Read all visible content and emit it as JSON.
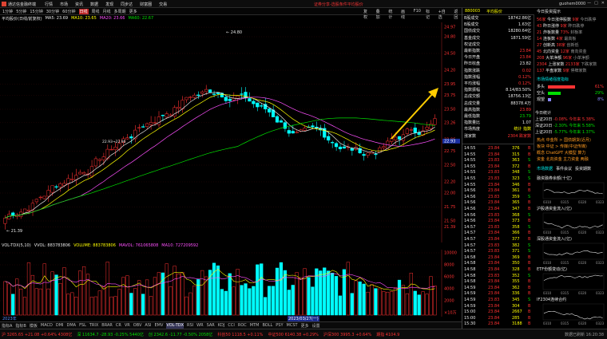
{
  "titlebar": {
    "app": "通达信金融终端",
    "menu": [
      "行情",
      "市场",
      "资讯",
      "数据",
      "发现",
      "同步达",
      "财富圈",
      "交易"
    ],
    "center": "证券分享-选股条件平均股价",
    "right": "guohem0000",
    "win_buttons": [
      "—",
      "□",
      "✕"
    ]
  },
  "toolbar": {
    "periods": [
      "1分钟",
      "5分钟",
      "15分钟",
      "30分钟",
      "60分钟",
      "日线",
      "周线",
      "月线",
      "多周期",
      "更多"
    ],
    "active_period": "日线",
    "tools": [
      "复权",
      "叠加",
      "统计",
      "画线",
      "F10",
      "标记",
      "+自选",
      "返回"
    ]
  },
  "legend": {
    "name": "平均股价(日线/前复权)",
    "ma": [
      {
        "text": "MA5: 23.69",
        "color": "#e8e8e8"
      },
      {
        "text": "MA10: 23.65",
        "color": "#ffff00"
      },
      {
        "text": "MA20: 23.66",
        "color": "#ff50ff"
      },
      {
        "text": "MA60: 22.67",
        "color": "#00e000"
      }
    ]
  },
  "price_axis": {
    "ticks": [
      "24.97",
      "24.80",
      "24.50",
      "24.20",
      "23.95",
      "23.75",
      "23.50",
      "23.26",
      "22.96",
      "22.75",
      "22.50",
      "22.20",
      "22.00",
      "21.75",
      "21.50",
      "21.39"
    ],
    "current": "22.93"
  },
  "annotations": {
    "high": "24.80",
    "low": "21.39",
    "mark": "22.93→22.96"
  },
  "vol_legend": {
    "items": [
      {
        "text": "VOL-TDX(5,10)",
        "color": "#e8e8e8"
      },
      {
        "text": "VVOL: 883783806",
        "color": "#e8e8e8"
      },
      {
        "text": "VOLUME: 883783806",
        "color": "#ffff00"
      },
      {
        "text": "MAVOL: 761065808",
        "color": "#ff50ff"
      },
      {
        "text": "MA10: 727209592",
        "color": "#ff50ff"
      }
    ]
  },
  "vol_axis": {
    "ticks": [
      "10000",
      "8000",
      "6000",
      "4000",
      "2000",
      "×10万"
    ]
  },
  "date_strip": {
    "left": "2023年",
    "mid": "2023/03/27(一)"
  },
  "indicator_tabs": {
    "items": [
      "指标A",
      "指标B",
      "模板",
      "MACD",
      "DMI",
      "DMA",
      "FSL",
      "TRIX",
      "BRAR",
      "CR",
      "VR",
      "OBV",
      "ASI",
      "EMV",
      "VOL-TDX",
      "RSI",
      "WR",
      "SAR",
      "KDJ",
      "CCI",
      "ROC",
      "MTM",
      "BOLL",
      "PSY",
      "MCST",
      "更多",
      "设置"
    ],
    "active": "VOL-TDX"
  },
  "quote": {
    "code": "880003",
    "name": "平均股价",
    "rows": [
      {
        "label": "B股成交",
        "value": "18742.86亿",
        "cls": "white"
      },
      {
        "label": "B股成交",
        "value": "1.63亿",
        "cls": "white"
      },
      {
        "label": "国债成交",
        "value": "18280.64亿",
        "cls": "white"
      },
      {
        "label": "基金成交",
        "value": "1871.59亿",
        "cls": "white"
      },
      {
        "label": "权证成交",
        "value": "",
        "cls": "white"
      },
      {
        "label": "最新指数",
        "value": "23.84",
        "cls": "red"
      },
      {
        "label": "今日开盘",
        "value": "23.84",
        "cls": "red"
      },
      {
        "label": "昨日收盘",
        "value": "23.82",
        "cls": "white"
      },
      {
        "label": "指数涨跌",
        "value": "0.02",
        "cls": "red"
      },
      {
        "label": "指数涨幅",
        "value": "0.12%",
        "cls": "red"
      },
      {
        "label": "平均涨幅",
        "value": "0.12%",
        "cls": "red"
      },
      {
        "label": "指数振幅",
        "value": "8.14/83.50%",
        "cls": "white"
      },
      {
        "label": "总成交额",
        "value": "18756.13亿",
        "cls": "white"
      },
      {
        "label": "总成交量",
        "value": "88378.4万",
        "cls": "white"
      },
      {
        "label": "最高指数",
        "value": "23.89",
        "cls": "red"
      },
      {
        "label": "最低指数",
        "value": "23.79",
        "cls": "green"
      },
      {
        "label": "指数量比",
        "value": "1.07",
        "cls": "white"
      },
      {
        "label": "市场热度",
        "value": "统计 指数",
        "cls": "yellow"
      },
      {
        "label": "涨家数",
        "value": "2304 跌家数",
        "cls": "red"
      }
    ],
    "breadth": [
      {
        "label": "今日统计",
        "value": "",
        "cls": "yellow"
      },
      {
        "label": "上证20日",
        "value": "-0.08% 今年来 5.38%",
        "cls": "red"
      },
      {
        "label": "深证20日",
        "value": "-2.30% 今年来 5.58%",
        "cls": "green"
      },
      {
        "label": "上证20日",
        "value": "-5.77% 今年来 1.37%",
        "cls": "green"
      }
    ]
  },
  "ticks": [
    {
      "time": "14:55",
      "price": "23.84",
      "vol": "376",
      "side": "B"
    },
    {
      "time": "14:55",
      "price": "23.84",
      "vol": "315",
      "side": "B"
    },
    {
      "time": "14:55",
      "price": "23.83",
      "vol": "363",
      "side": "S"
    },
    {
      "time": "14:55",
      "price": "23.84",
      "vol": "372",
      "side": "B"
    },
    {
      "time": "14:55",
      "price": "23.83",
      "vol": "348",
      "side": "S"
    },
    {
      "time": "14:55",
      "price": "23.83",
      "vol": "323",
      "side": "S"
    },
    {
      "time": "14:55",
      "price": "23.84",
      "vol": "346",
      "side": "B"
    },
    {
      "time": "14:56",
      "price": "23.84",
      "vol": "361",
      "side": "B"
    },
    {
      "time": "14:56",
      "price": "23.83",
      "vol": "359",
      "side": "S"
    },
    {
      "time": "14:56",
      "price": "23.84",
      "vol": "365",
      "side": "B"
    },
    {
      "time": "14:56",
      "price": "23.84",
      "vol": "347",
      "side": "B"
    },
    {
      "time": "14:56",
      "price": "23.83",
      "vol": "368",
      "side": "S"
    },
    {
      "time": "14:56",
      "price": "23.84",
      "vol": "373",
      "side": "B"
    },
    {
      "time": "14:57",
      "price": "23.83",
      "vol": "358",
      "side": "S"
    },
    {
      "time": "14:57",
      "price": "23.84",
      "vol": "366",
      "side": "B"
    },
    {
      "time": "14:57",
      "price": "23.84",
      "vol": "377",
      "side": "B"
    },
    {
      "time": "14:57",
      "price": "23.83",
      "vol": "382",
      "side": "S"
    },
    {
      "time": "14:57",
      "price": "23.83",
      "vol": "371",
      "side": "S"
    },
    {
      "time": "14:58",
      "price": "23.84",
      "vol": "369",
      "side": "B"
    },
    {
      "time": "14:58",
      "price": "23.84",
      "vol": "350",
      "side": "B"
    },
    {
      "time": "14:58",
      "price": "23.84",
      "vol": "328",
      "side": "B"
    },
    {
      "time": "14:58",
      "price": "23.83",
      "vol": "352",
      "side": "S"
    },
    {
      "time": "14:58",
      "price": "23.84",
      "vol": "355",
      "side": "B"
    },
    {
      "time": "14:59",
      "price": "23.84",
      "vol": "362",
      "side": "B"
    },
    {
      "time": "14:59",
      "price": "23.84",
      "vol": "336",
      "side": "B"
    },
    {
      "time": "14:59",
      "price": "23.83",
      "vol": "345",
      "side": "S"
    },
    {
      "time": "14:59",
      "price": "23.84",
      "vol": "304",
      "side": "B"
    },
    {
      "time": "15:00",
      "price": "23.84",
      "vol": "2667",
      "side": "B"
    },
    {
      "time": "15:00",
      "price": "23.84",
      "vol": "285",
      "side": "B"
    },
    {
      "time": "15:30",
      "price": "23.84",
      "vol": "3188",
      "side": "B"
    }
  ],
  "news": {
    "title": "今日投资提示",
    "stats": [
      {
        "label": "今日涨停股数",
        "v1": "56家",
        "label2": "今日跌停",
        "v2": "9家"
      },
      {
        "label": "昨日涨停",
        "v1": "43",
        "label2": "昨日跌停",
        "v2": "9家"
      },
      {
        "label": "炸板数量",
        "v1": "21",
        "label2": "封板率",
        "v2": "73%"
      },
      {
        "label": "连板数",
        "v1": "14",
        "label2": "最高板",
        "v2": "4家"
      },
      {
        "label": "创新高",
        "v1": "27",
        "label2": "创新低",
        "v2": "38家"
      },
      {
        "label": "北向资金",
        "v1": "45",
        "label2": "南向资金",
        "v2": "12家"
      },
      {
        "label": "大单净额",
        "v1": "208",
        "label2": "小单净额",
        "v2": "96家"
      },
      {
        "label": "上涨家数",
        "v1": "2304",
        "label2": "下跌家数",
        "v2": "2133家"
      },
      {
        "label": "平盘家数",
        "v1": "137",
        "label2": "停牌家数",
        "v2": "9家"
      }
    ],
    "subhead": "市场情绪强度指标",
    "bars": [
      {
        "label": "多头",
        "value": "61%",
        "color": "#ff3232"
      },
      {
        "label": "空头",
        "value": "29%",
        "color": "#00e000"
      },
      {
        "label": "观望",
        "value": "8%",
        "color": "#8888ff"
      }
    ],
    "links": [
      "热点 中金所 > 国债期货(近月)",
      "板块 中证 > 传媒(中证传媒)",
      "概念 ChatGPT 大模型 算力",
      "资金 北向资金 主力资金 两融"
    ],
    "tabs": [
      "市场数据",
      "事件会议",
      "投资期数"
    ],
    "mini_titles": [
      "融资融券余额(十亿)",
      "沪股通资金流入(亿)",
      "深股通资金流入(亿)",
      "ETF份额变动(亿)",
      "IF2304连续合约"
    ],
    "mini_dates": [
      "0310",
      "0315",
      "0320",
      "0323"
    ]
  },
  "statusbar": {
    "items": [
      {
        "text": "沪 3265.65 +21.08 +0.64% 4308亿",
        "cls": "red"
      },
      {
        "text": "深 11634.7 -28.93 -0.25% 5440亿",
        "cls": "green"
      },
      {
        "text": "创 2342.6 -11.77 -0.50% 2058亿",
        "cls": "green"
      },
      {
        "text": "科创50 1118.5 +0.11%",
        "cls": "red"
      },
      {
        "text": "中证500 6140.38 +0.29%",
        "cls": "red"
      },
      {
        "text": "沪深300 3995.3 +0.64%",
        "cls": "red"
      },
      {
        "text": "期指 4104.9",
        "cls": "red"
      }
    ],
    "right": "数据已刷新 16:20:38"
  },
  "colors": {
    "up": "#ff3232",
    "down": "#00ffff",
    "ma5": "#e8e8e8",
    "ma10": "#ffff00",
    "ma20": "#ff50ff",
    "ma60": "#00e000",
    "arrow": "#ffcc00"
  }
}
